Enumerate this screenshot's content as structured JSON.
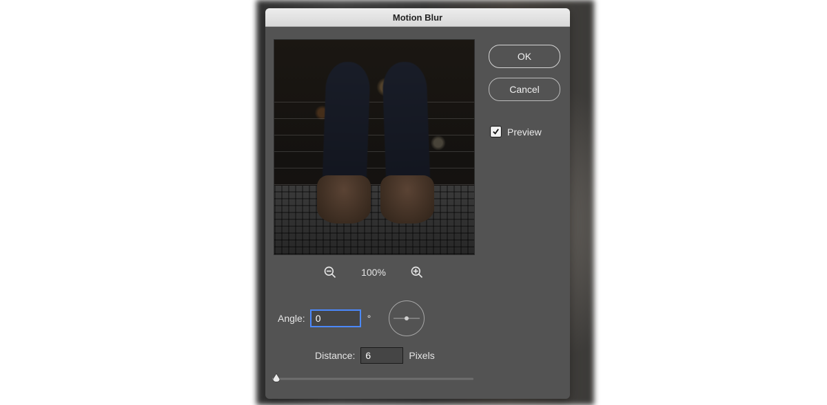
{
  "dialog": {
    "title": "Motion Blur",
    "zoom_label": "100%",
    "angle_label": "Angle:",
    "angle_value": "0",
    "distance_label": "Distance:",
    "distance_value": "6",
    "distance_unit": "Pixels",
    "ok_label": "OK",
    "cancel_label": "Cancel",
    "preview_label": "Preview",
    "preview_checked": true,
    "slider_percent": 2,
    "colors": {
      "panel": "#535353",
      "titlebar_top": "#ededed",
      "titlebar_bottom": "#d8d8d8",
      "focus_ring": "#4b89ff"
    }
  }
}
